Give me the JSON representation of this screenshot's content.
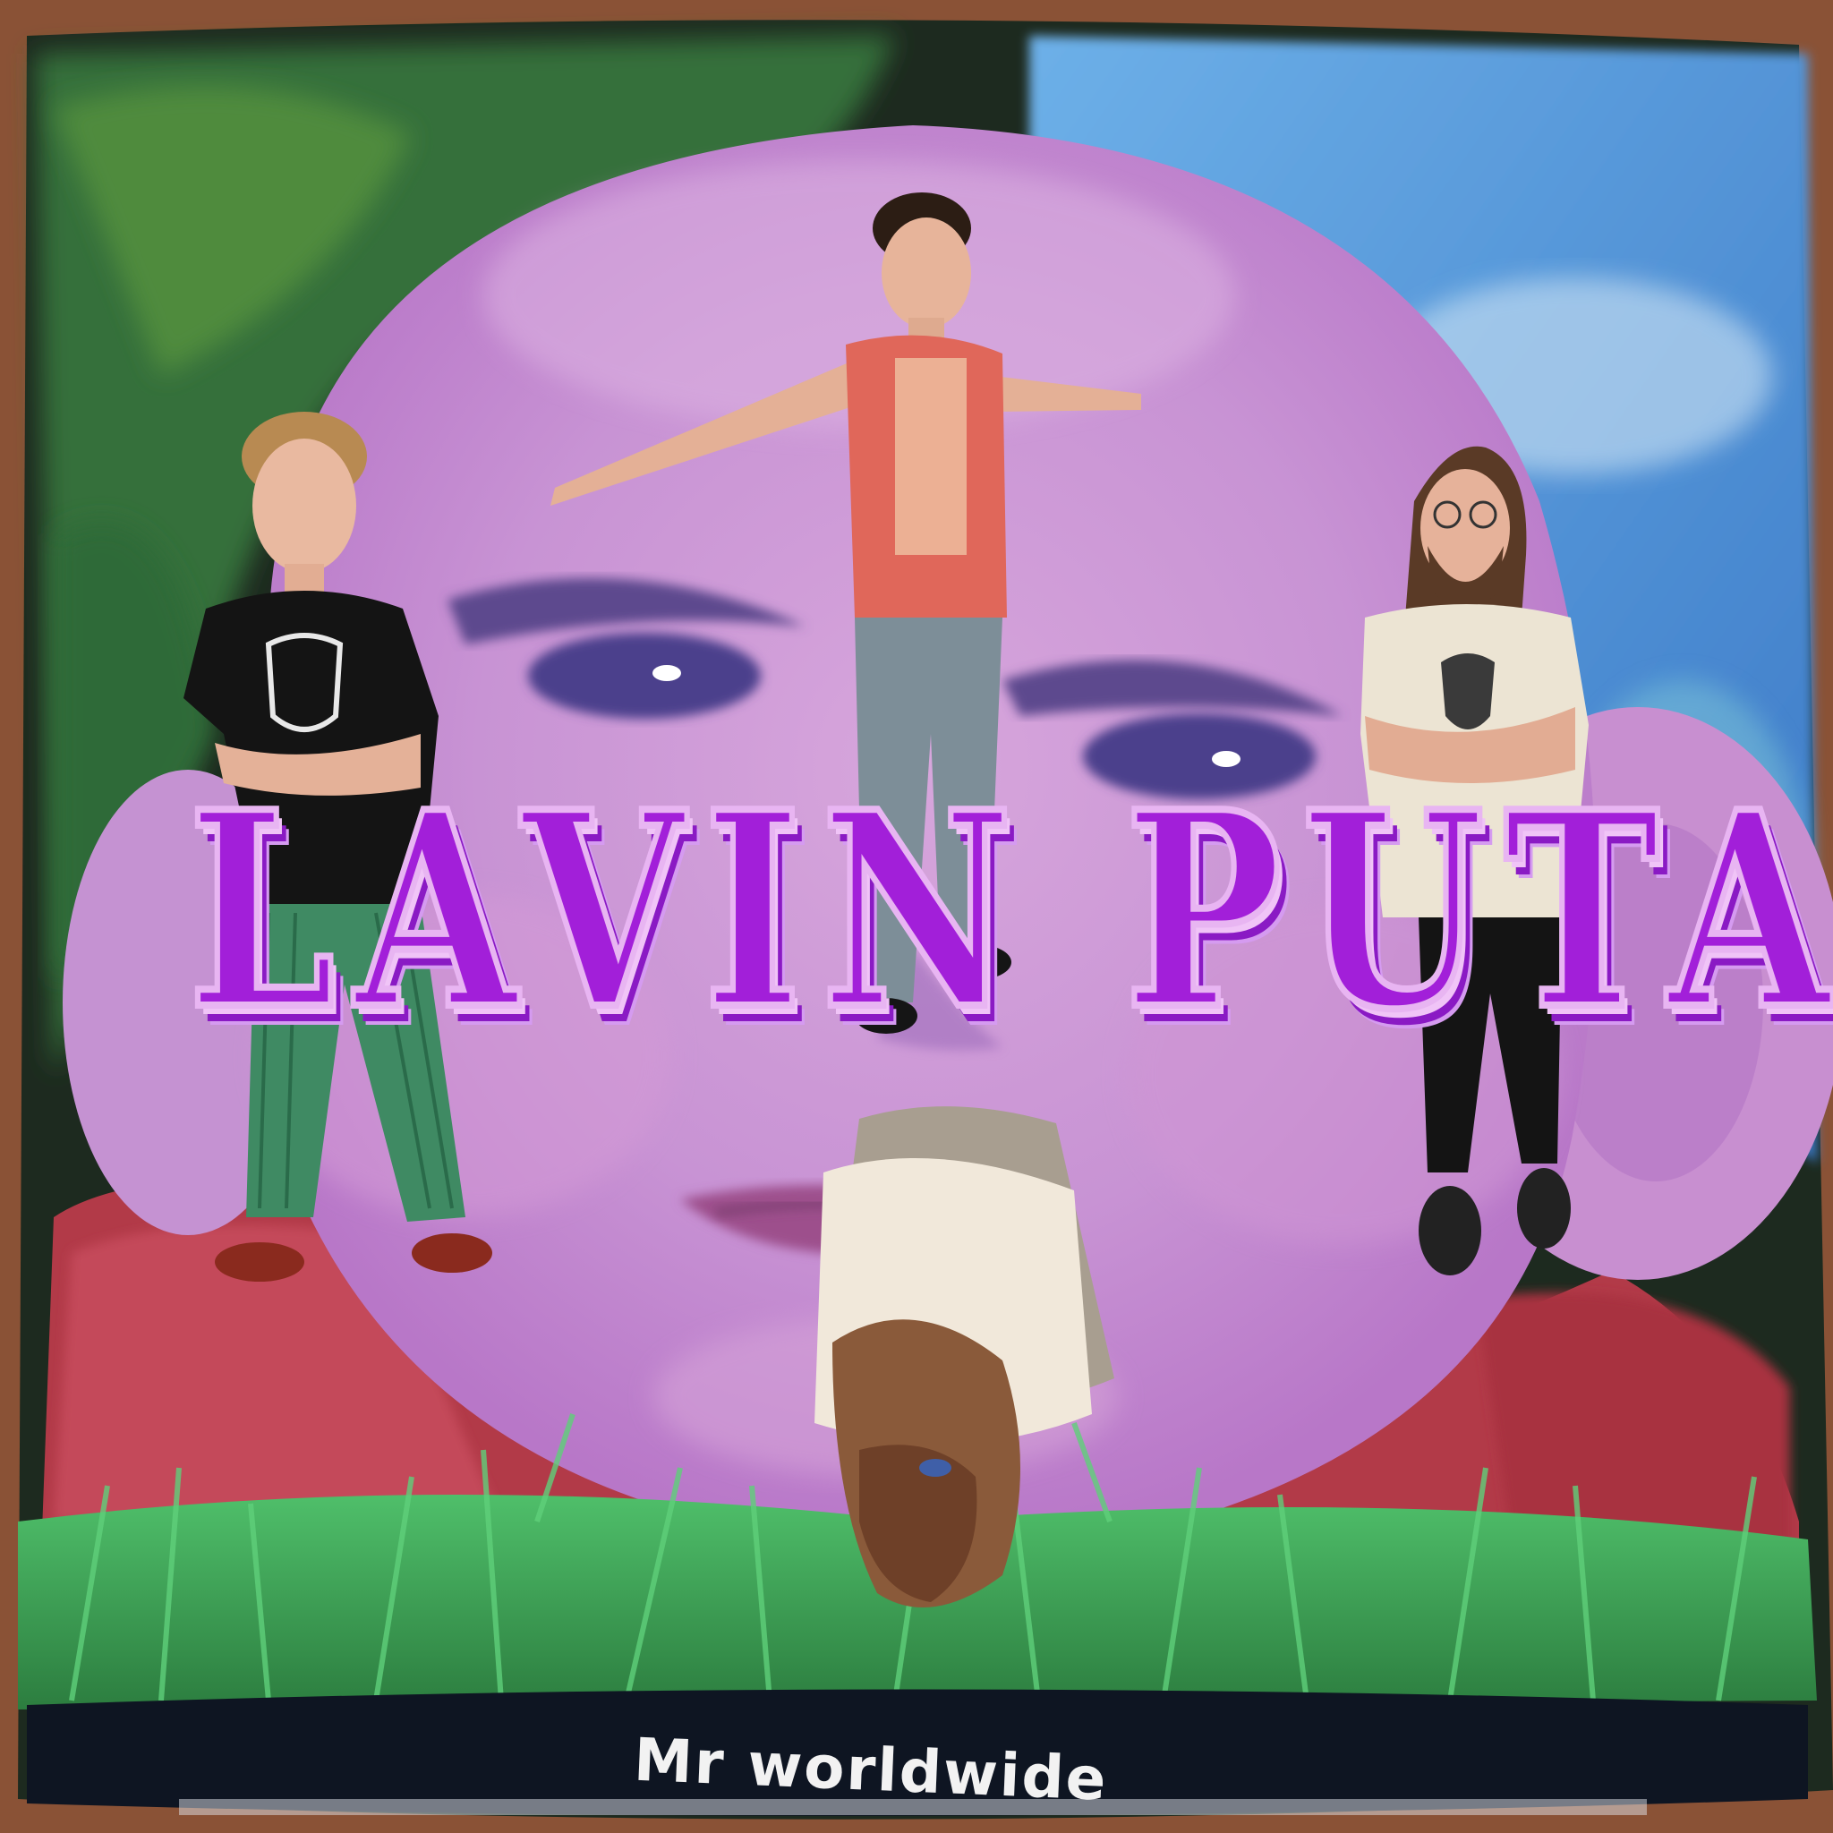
{
  "title_text": "LAVIN PUTA",
  "caption_text": "Mr worldwide",
  "colors": {
    "title_fill": "#a21fd9",
    "title_outline": "#e8b5f2",
    "face": "#c89ad6",
    "sky": "#4d8fd0",
    "grass": "#3fa05a",
    "banner": "#0e1522",
    "frame": "#8a5236"
  }
}
